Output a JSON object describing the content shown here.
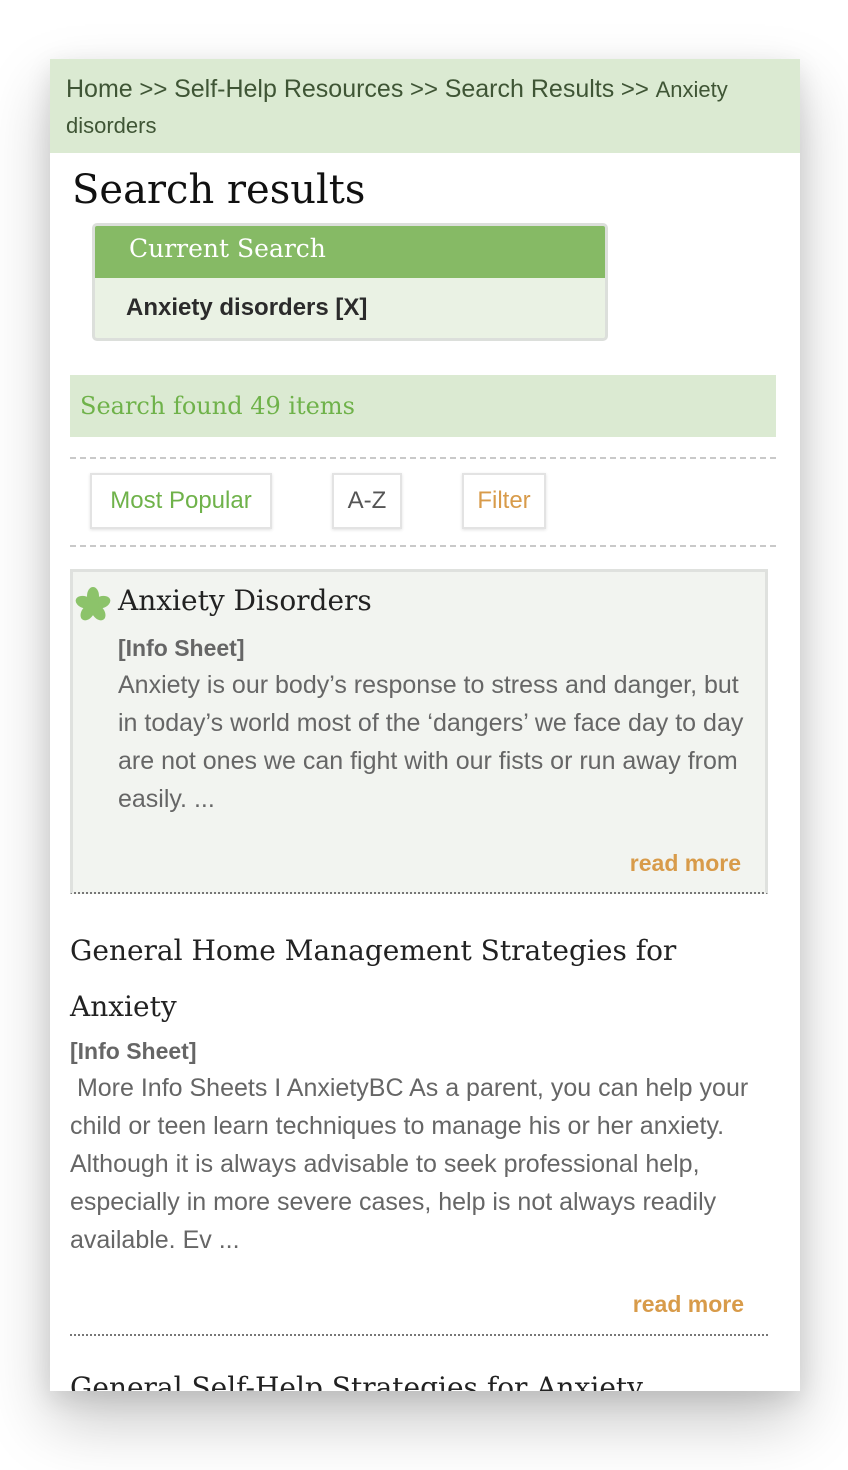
{
  "breadcrumb": {
    "home": "Home",
    "sep": ">>",
    "self_help": "Self-Help Resources",
    "search_results": "Search Results",
    "current": "Anxiety disorders"
  },
  "page_title": "Search results",
  "current_search": {
    "heading": "Current Search",
    "term": "Anxiety disorders [X]"
  },
  "found_text": "Search found 49 items",
  "sort": {
    "most_popular": "Most Popular",
    "az": "A-Z",
    "filter": "Filter"
  },
  "colors": {
    "accent_green": "#86ba65",
    "light_green": "#dbead2",
    "orange": "#d89b4a"
  },
  "results": [
    {
      "icon": "star-icon",
      "title": "Anxiety Disorders",
      "type": "[Info Sheet]",
      "excerpt": "Anxiety is our body’s response to stress and danger, but in today’s world most of the ‘dangers’ we face day to day are not ones we can fight with our fists or run away from easily. ...",
      "read_more": "read more"
    },
    {
      "title": "General Home Management Strategies for Anxiety",
      "type": "[Info Sheet]",
      "excerpt": " More Info Sheets I AnxietyBC As a parent, you can help your child or teen learn techniques to manage his or her anxiety. Although it is always advisable to seek professional help, especially in more severe cases, help is not always readily available. Ev ...",
      "read_more": "read more"
    },
    {
      "title": "General Self-Help Strategies for Anxiety"
    }
  ]
}
